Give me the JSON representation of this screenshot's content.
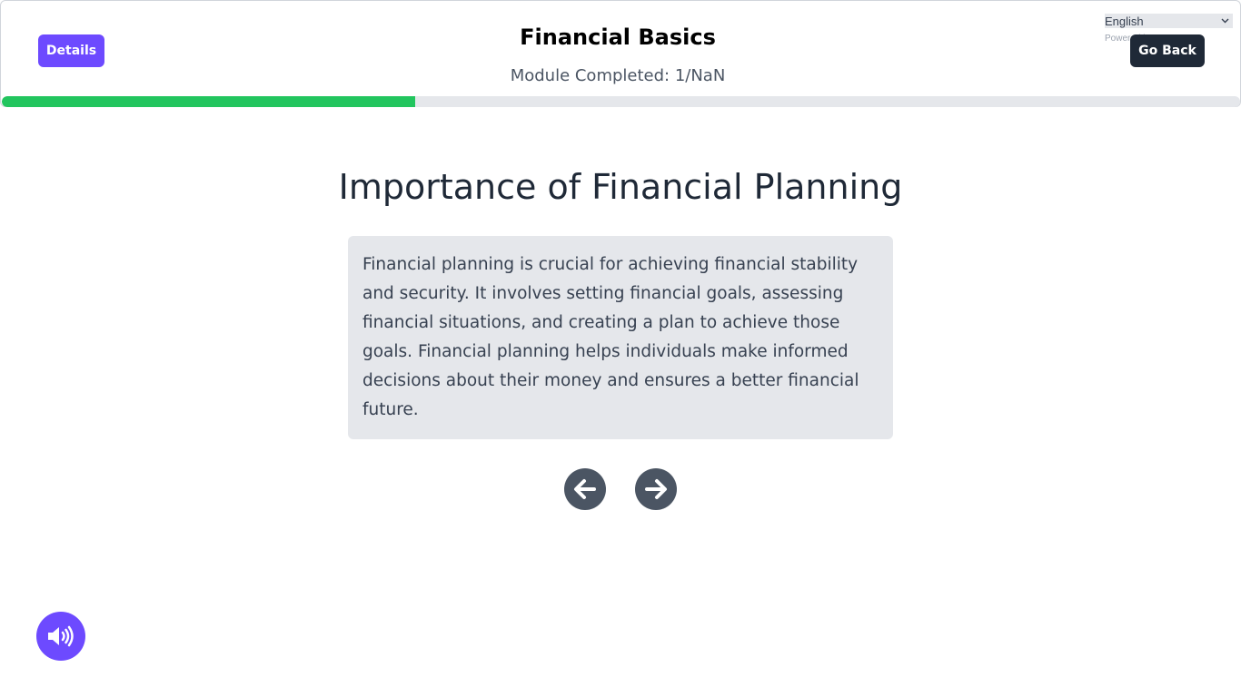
{
  "header": {
    "details_label": "Details",
    "course_title": "Financial Basics",
    "module_progress_text": "Module Completed: 1/NaN",
    "language": {
      "selected": "English",
      "powered_by": "Powered by"
    },
    "go_back_label": "Go Back",
    "progress_fraction": 0.334
  },
  "lesson": {
    "title": "Importance of Financial Planning",
    "body": "Financial planning is crucial for achieving financial stability and security. It involves setting financial goals, assessing financial situations, and creating a plan to achieve those goals. Financial planning helps individuals make informed decisions about their money and ensures a better financial future."
  },
  "navigation": {
    "prev_icon": "arrow-left-icon",
    "next_icon": "arrow-right-icon"
  },
  "audio": {
    "icon": "speaker-icon"
  },
  "colors": {
    "accent": "#6d4aff",
    "dark_button": "#1f2937",
    "progress": "#22c55e",
    "card_bg": "#e5e7eb",
    "nav_button": "#4b5563"
  }
}
